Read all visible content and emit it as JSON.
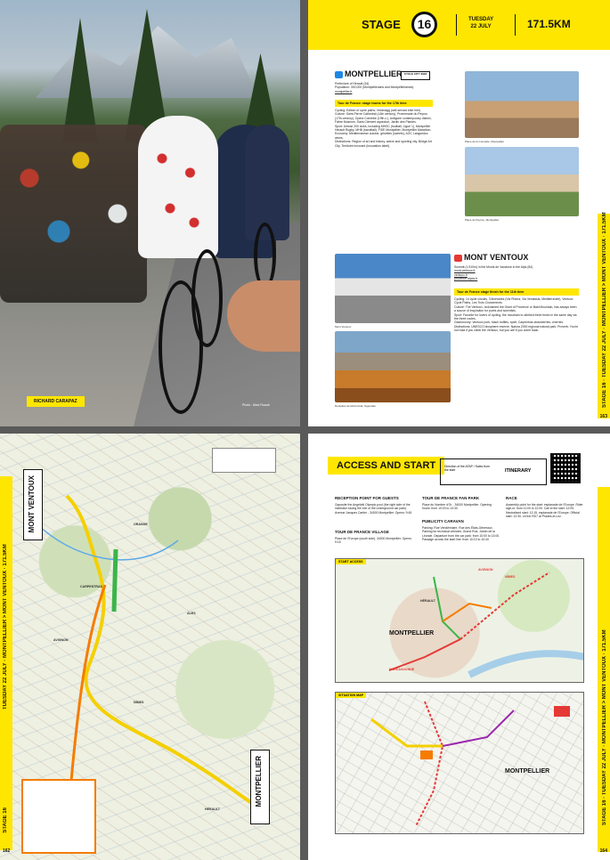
{
  "page1": {
    "credit_tag": "RICHARD CARAPAZ",
    "credit_photo": "Photo : Alice Ruault"
  },
  "page2": {
    "stage_word": "STAGE",
    "stage_number": "16",
    "day": "TUESDAY",
    "date": "22 JULY",
    "distance": "171.5KM",
    "start": {
      "name": "MONTPELLIER",
      "prefecture": "Prefecture of Hérault (34)",
      "population": "Population: 300,000 (Montpellierains and Montpelliéraines)",
      "web": "montpellier.fr",
      "cycle_tag": "CYCLE CITY 2023",
      "band": "Tour de France: stage towns for the 17th time",
      "cycling": "Cycling: Edition of cycle paths; Velomagg (self-service bike hire)",
      "culture": "Culture: Saint-Pierre Cathedral (14th century), Promenade du Peyrou (17th century), Opéra Comédie (19th c.), Antigone contemporary district, Fabre Museum, Saint-Clément aqueduct, Jardin des Plantes.",
      "sport": "Sport: Almost 200 clubs, including MHSC (football, Ligue 1), Montpellier Hérault Rugby, MHB (handball), FISE Montpellier, Montpellier Marathon.",
      "economy": "Economy: Mediterranean cuisine, grisettes (sweets), AOC Languedoc wines.",
      "distinctions": "Distinctions: Region of art and history, active and sporting city, Bridge Art City, Territoire innovant (innovation label).",
      "cap1": "Place de la Comédie, Montpellier",
      "cap2": "Place du Peyrou, Montpellier"
    },
    "finish": {
      "name": "MONT VENTOUX",
      "summit": "Summit (1,910m) in the Monts de Vaucluse in the Alps (84)",
      "web1": "mont-ventoux.fr",
      "web2": "ventoux.fr",
      "web3": "provence-alpes.fr",
      "band": "Tour de France stage finish for the 11th time",
      "cycling": "Cycling: 14 cycle circuits, 3 itineraries (Via Rhôna, Via Venaissia, Méditerranée), Ventoux Cycle Paths, Les Trois Croisements.",
      "culture": "Culture: The Ventoux, nicknamed the Giant of Provence or Bald Mountain, has always been a source of inspiration for poets and scientists.",
      "sport": "Sport: Favorite for lovers of cycling, the mountain is climbed three times in the same day via the three routes.",
      "gastronomy": "Gastronomy: Ventoux pork, black truffles, spelt, Carpentras strawberries, cherries.",
      "distinctions": "Distinctions: UNESCO biosphere reserve, Natura 2000 regional natural park. Proverb: You're not mad if you climb the Ventoux, but you are if you come back.",
      "cap1": "Mont Ventoux",
      "cap2": "Dentelles de Montmirail, Gigondas"
    },
    "side_text": "STAGE 16 · TUESDAY 22 JULY · MONTPELLIER > MONT VENTOUX · 171.5KM",
    "page_num": "163"
  },
  "page3": {
    "finish_label": "MONT VENTOUX",
    "start_label": "MONTPELLIER",
    "side_text": "TUESDAY 22 JULY · MONTPELLIER > MONT VENTOUX · 171.5KM",
    "stage_label": "STAGE 16",
    "page_num": "162",
    "towns": [
      "CARPENTRAS",
      "ORANGE",
      "AVIGNON",
      "NÎMES",
      "HÉRAULT",
      "ALÈS"
    ]
  },
  "page4": {
    "title": "ACCESS AND START",
    "itinerary_label": "ITINERARY",
    "itinerary_text": "Direction of the ATAP / Sales from the start",
    "reception": {
      "title": "RECEPTION POINT FOR GUESTS",
      "text": "Opposite the Angelotti Olympic pool (the right side of the institution facing the exit of the underground car park). Avenue Jacques Cartier - 34000 Montpellier. Opens: 9:45"
    },
    "village": {
      "title": "TOUR DE FRANCE VILLAGE",
      "text": "Place de l'Europe (south side), 34000 Montpellier. Opens: 9:15"
    },
    "fanpark": {
      "title": "TOUR DE FRANCE FAN PARK",
      "text": "Place du Nombre d'Or - 34000 Montpellier. Opening hours: from 10:00 to 13:30"
    },
    "caravan": {
      "title": "PUBLICITY CARAVAN",
      "text": "Parking: Rue Vendémiaire, Rue des États-Généraux. Parking for technical vehicles: Grand Rue, Jardin de la Lironde. Departure from the car park: from 10:00 to 13:00. Passage across the start line: from 10:10 to 10:40"
    },
    "race": {
      "title": "RACE",
      "text": "Assembly point for the start: esplanade de l'Europe. Rider sign-in: from 11:00 to 12:00. Call to the start: 12:05. Neutralised start: 12:15, esplanade de l'Europe. Official start: 12:30, on the RD7 at Prades-le-Lez."
    },
    "start_access": "START ACCESS",
    "situation_map": "SITUATION MAP",
    "map_city": "MONTPELLIER",
    "map_city2": "MONTPELLIER",
    "towns": [
      "AVIGNON",
      "NÎMES",
      "HÉRAULT",
      "CARCASSONNE"
    ],
    "side_text": "STAGE 16 · TUESDAY 22 JULY · MONTPELLIER > MONT VENTOUX · 171.5KM",
    "page_num": "164"
  }
}
